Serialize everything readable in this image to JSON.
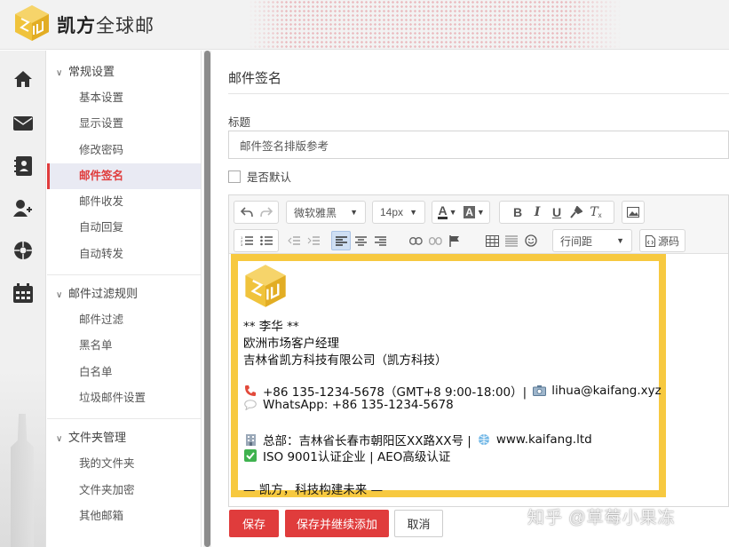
{
  "app": {
    "brand_strong": "凯方",
    "brand_rest": "全球邮"
  },
  "nav": {
    "groups": [
      {
        "label": "常规设置",
        "items": [
          "基本设置",
          "显示设置",
          "修改密码",
          "邮件签名",
          "邮件收发",
          "自动回复",
          "自动转发"
        ]
      },
      {
        "label": "邮件过滤规则",
        "items": [
          "邮件过滤",
          "黑名单",
          "白名单",
          "垃圾邮件设置"
        ]
      },
      {
        "label": "文件夹管理",
        "items": [
          "我的文件夹",
          "文件夹加密",
          "其他邮箱"
        ]
      }
    ],
    "active_item": "邮件签名"
  },
  "main": {
    "page_title": "邮件签名",
    "field_title_label": "标题",
    "title_value": "邮件签名排版参考",
    "default_checkbox_label": "是否默认",
    "default_checked": false
  },
  "toolbar": {
    "font_family": "微软雅黑",
    "font_size": "14px",
    "line_spacing": "行间距",
    "source_label": "源码"
  },
  "signature": {
    "name_line": "** 李华 **",
    "position": "欧洲市场客户经理",
    "company": "吉林省凯方科技有限公司（凯方科技）",
    "phone_line": "+86 135-1234-5678（GMT+8 9:00-18:00）|",
    "email": "lihua@kaifang.xyz",
    "whatsapp": "WhatsApp: +86 135-1234-5678",
    "address_line": "总部：吉林省长春市朝阳区XX路XX号 |",
    "website": "www.kaifang.ltd",
    "cert_line": "ISO 9001认证企业 | AEO高级认证",
    "slogan": "— 凯方，科技构建未来 —",
    "border_color": "#f7c940"
  },
  "actions": {
    "save": "保存",
    "save_continue": "保存并继续添加",
    "cancel": "取消"
  },
  "watermark": "知乎 @草莓小果冻",
  "colors": {
    "accent": "#e03c3c",
    "logo_gold": "#f0c33c"
  }
}
